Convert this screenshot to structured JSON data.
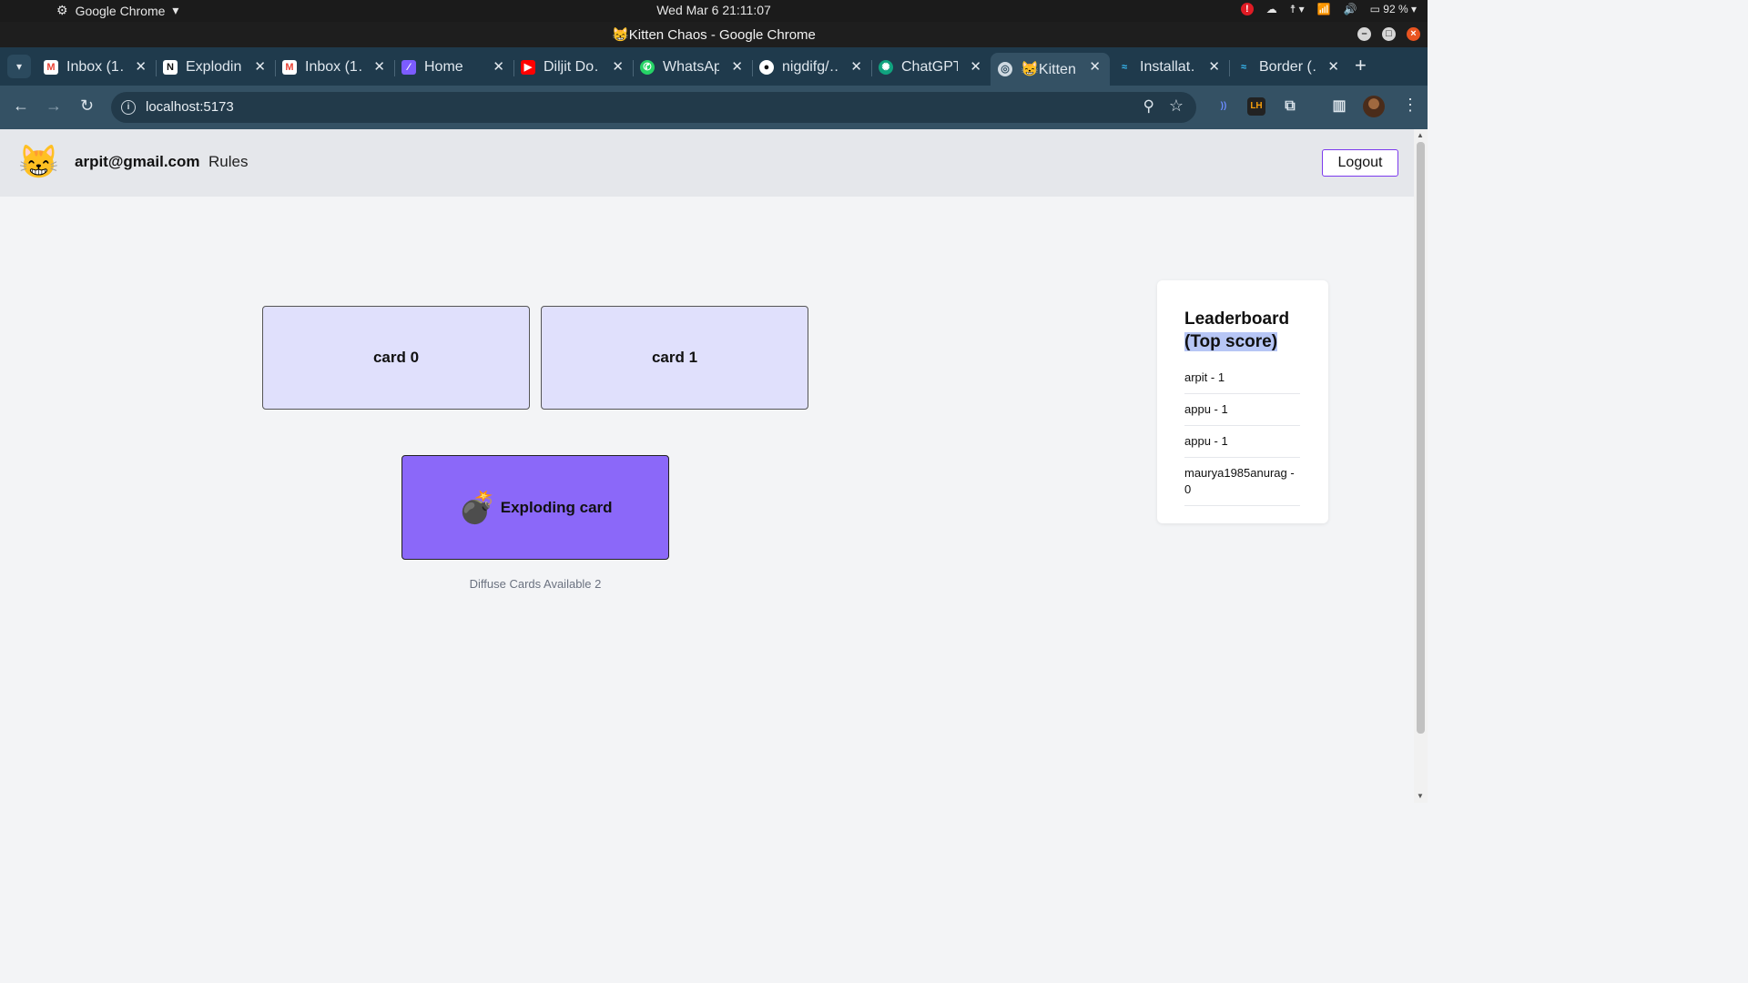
{
  "os": {
    "app_name": "Google Chrome",
    "clock": "Wed Mar 6  21:11:07",
    "battery": "92 %"
  },
  "window": {
    "title": "😸Kitten Chaos - Google Chrome"
  },
  "tabs": [
    {
      "label": "Inbox (1…",
      "icon": "gmail-icon",
      "color": "#ea4335"
    },
    {
      "label": "Exploding…",
      "icon": "notion-icon",
      "color": "#ffffff"
    },
    {
      "label": "Inbox (1…",
      "icon": "gmail-icon",
      "color": "#ea4335"
    },
    {
      "label": "Home",
      "icon": "home-app-icon",
      "color": "#7c5cff"
    },
    {
      "label": "Diljit Do…",
      "icon": "youtube-icon",
      "color": "#ff0000"
    },
    {
      "label": "WhatsApp",
      "icon": "whatsapp-icon",
      "color": "#25d366"
    },
    {
      "label": "nigdifg/…",
      "icon": "github-icon",
      "color": "#ffffff"
    },
    {
      "label": "ChatGPT",
      "icon": "chatgpt-icon",
      "color": "#10a37f"
    },
    {
      "label": "😸Kitten…",
      "icon": "globe-icon",
      "color": "#cfd9e1",
      "active": true
    },
    {
      "label": "Installat…",
      "icon": "tailwind-icon",
      "color": "#38bdf8"
    },
    {
      "label": "Border (…",
      "icon": "tailwind-icon",
      "color": "#38bdf8"
    }
  ],
  "toolbar": {
    "url": "localhost:5173"
  },
  "nav": {
    "logo": "😸",
    "email": "arpit@gmail.com",
    "rules": "Rules",
    "logout": "Logout"
  },
  "game": {
    "cards": [
      "card 0",
      "card 1"
    ],
    "active_card": {
      "icon": "💣",
      "label": "Exploding card"
    },
    "diffuse_text": "Diffuse Cards Available 2"
  },
  "leaderboard": {
    "title_line1": "Leaderboard",
    "title_line2": "(Top score)",
    "entries": [
      "arpit - 1",
      "appu - 1",
      "appu - 1",
      "maurya1985anurag - 0"
    ]
  },
  "colors": {
    "accent": "#7c3aed",
    "card_bg": "#e0e0fc",
    "active_card_bg": "#8b68f9"
  }
}
